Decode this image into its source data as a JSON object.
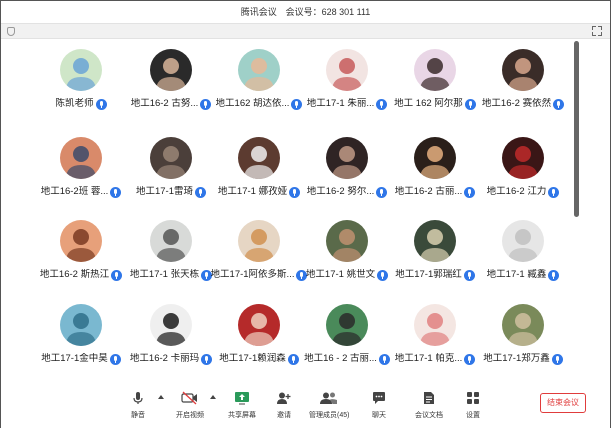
{
  "titlebar": {
    "app_name": "腾讯会议",
    "meeting_id_label": "会议号：628 301 111"
  },
  "participants": [
    {
      "name": "陈凯老师",
      "bg": "#cfe6c8",
      "fg": "#6aa3d6"
    },
    {
      "name": "地工16-2 古努...",
      "bg": "#2a2a2a",
      "fg": "#d8b59a"
    },
    {
      "name": "地工162 胡达依...",
      "bg": "#9fd0c8",
      "fg": "#e8b896"
    },
    {
      "name": "地工17-1 朱丽...",
      "bg": "#f2e4e2",
      "fg": "#c75b5b"
    },
    {
      "name": "地工 162  阿尔那",
      "bg": "#e9d6e6",
      "fg": "#3a2a2a"
    },
    {
      "name": "地工16-2 赛依然",
      "bg": "#3a2c28",
      "fg": "#d9a88d"
    },
    {
      "name": "地工16-2班  蓉...",
      "bg": "#d98a6a",
      "fg": "#3b4a6b"
    },
    {
      "name": "地工17-1雷琦",
      "bg": "#4b3f3a",
      "fg": "#9a8677"
    },
    {
      "name": "地工17-1  娜孜娅",
      "bg": "#5c3b30",
      "fg": "#f0f0f0"
    },
    {
      "name": "地工16-2  努尔...",
      "bg": "#2f2424",
      "fg": "#c09a86"
    },
    {
      "name": "地工16-2  古丽...",
      "bg": "#2a1f1a",
      "fg": "#e6b080"
    },
    {
      "name": "地工16-2 江力",
      "bg": "#3a1616",
      "fg": "#c02a2a"
    },
    {
      "name": "地工16-2 斯热江",
      "bg": "#e7a07a",
      "fg": "#7a3a22"
    },
    {
      "name": "地工17-1 张天栋",
      "bg": "#d8dad8",
      "fg": "#555"
    },
    {
      "name": "地工17-1阿依多斯...",
      "bg": "#e6d6c4",
      "fg": "#d09050"
    },
    {
      "name": "地工17-1 姚世文",
      "bg": "#5a6a4a",
      "fg": "#c09070"
    },
    {
      "name": "地工17-1郭瑞红",
      "bg": "#3a4a3a",
      "fg": "#d9d0b0"
    },
    {
      "name": "地工17-1 臧鑫",
      "bg": "#e6e6e6",
      "fg": "#bfbfbf"
    },
    {
      "name": "地工17-1金中昊",
      "bg": "#7ab8d0",
      "fg": "#2f6f8a"
    },
    {
      "name": "地工16-2 卡丽玛",
      "bg": "#efefef",
      "fg": "#1a1a1a"
    },
    {
      "name": "地工17-1赖润森",
      "bg": "#b52a2a",
      "fg": "#f0d0c0"
    },
    {
      "name": "地工16 - 2 古丽...",
      "bg": "#4a8a5a",
      "fg": "#2a2a2a"
    },
    {
      "name": "地工17-1 帕克...",
      "bg": "#f4e6e2",
      "fg": "#e08080"
    },
    {
      "name": "地工17-1郑万鑫",
      "bg": "#7a8a5a",
      "fg": "#d0c0a0"
    }
  ],
  "toolbar": {
    "mute": "静音",
    "start_video": "开启视频",
    "share_screen": "共享屏幕",
    "invite": "邀请",
    "manage_members": "管理成员(45)",
    "chat": "聊天",
    "meeting_docs": "会议文档",
    "settings": "设置",
    "end_meeting": "结束会议"
  }
}
